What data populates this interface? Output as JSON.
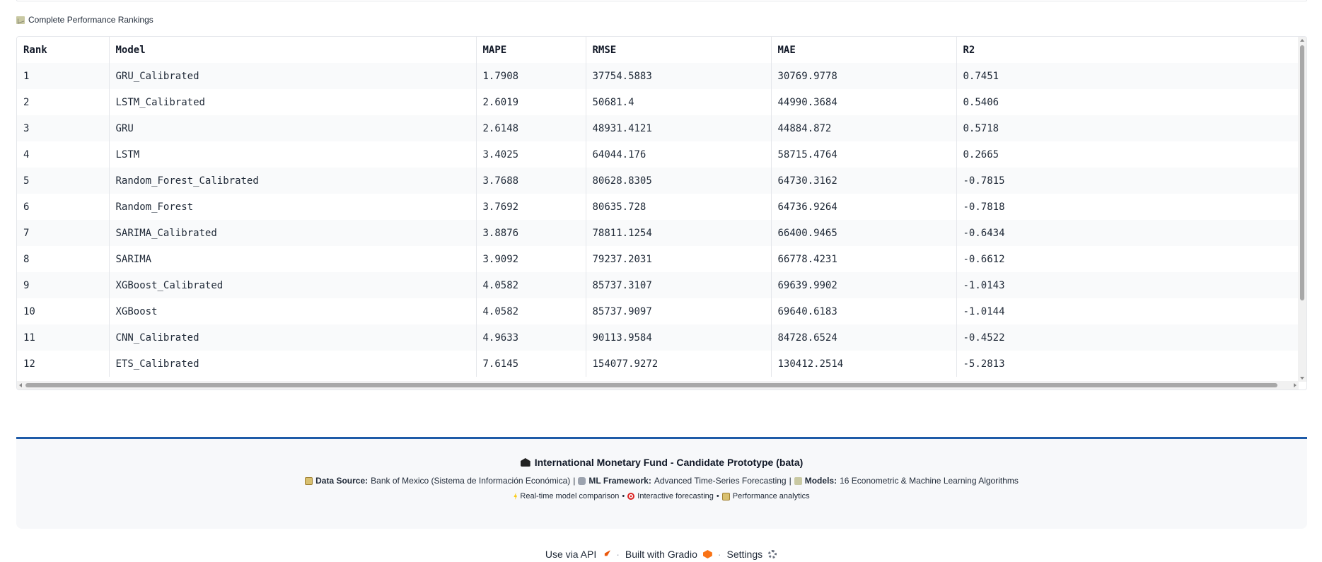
{
  "section": {
    "label": "Complete Performance Rankings"
  },
  "table": {
    "headers": [
      "Rank",
      "Model",
      "MAPE",
      "RMSE",
      "MAE",
      "R2"
    ],
    "rows": [
      [
        "1",
        "GRU_Calibrated",
        "1.7908",
        "37754.5883",
        "30769.9778",
        "0.7451"
      ],
      [
        "2",
        "LSTM_Calibrated",
        "2.6019",
        "50681.4",
        "44990.3684",
        "0.5406"
      ],
      [
        "3",
        "GRU",
        "2.6148",
        "48931.4121",
        "44884.872",
        "0.5718"
      ],
      [
        "4",
        "LSTM",
        "3.4025",
        "64044.176",
        "58715.4764",
        "0.2665"
      ],
      [
        "5",
        "Random_Forest_Calibrated",
        "3.7688",
        "80628.8305",
        "64730.3162",
        "-0.7815"
      ],
      [
        "6",
        "Random_Forest",
        "3.7692",
        "80635.728",
        "64736.9264",
        "-0.7818"
      ],
      [
        "7",
        "SARIMA_Calibrated",
        "3.8876",
        "78811.1254",
        "66400.9465",
        "-0.6434"
      ],
      [
        "8",
        "SARIMA",
        "3.9092",
        "79237.2031",
        "66778.4231",
        "-0.6612"
      ],
      [
        "9",
        "XGBoost_Calibrated",
        "4.0582",
        "85737.3107",
        "69639.9902",
        "-1.0143"
      ],
      [
        "10",
        "XGBoost",
        "4.0582",
        "85737.9097",
        "69640.6183",
        "-1.0144"
      ],
      [
        "11",
        "CNN_Calibrated",
        "4.9633",
        "90113.9584",
        "84728.6524",
        "-0.4522"
      ],
      [
        "12",
        "ETS_Calibrated",
        "7.6145",
        "154077.9272",
        "130412.2514",
        "-5.2813"
      ]
    ]
  },
  "footer": {
    "title": "International Monetary Fund - Candidate Prototype (bata)",
    "data_source_label": "Data Source:",
    "data_source_value": "Bank of Mexico (Sistema de Información Económica)",
    "sep1": "|",
    "framework_label": "ML Framework:",
    "framework_value": "Advanced Time-Series Forecasting",
    "sep2": "|",
    "models_label": "Models:",
    "models_value": "16 Econometric & Machine Learning Algorithms",
    "feature1": "Real-time model comparison",
    "bullet1": "•",
    "feature2": "Interactive forecasting",
    "bullet2": "•",
    "feature3": "Performance analytics"
  },
  "gradio_footer": {
    "api_label": "Use via API",
    "built_label": "Built with Gradio",
    "settings_label": "Settings",
    "separator": "·"
  },
  "colors": {
    "accent": "#1e5ba8",
    "stripe": "#f9fafb",
    "footer_bg": "#f7f8fa"
  },
  "icons": {
    "section": "chart-increasing-icon",
    "title": "bank-icon",
    "data_source": "bar-chart-icon",
    "framework": "robot-icon",
    "models": "chart-icon",
    "feature1": "lightning-icon",
    "feature2": "target-icon",
    "feature3": "bar-chart-icon",
    "api": "rocket-icon",
    "gradio": "gradio-logo-icon",
    "settings": "gear-icon"
  }
}
